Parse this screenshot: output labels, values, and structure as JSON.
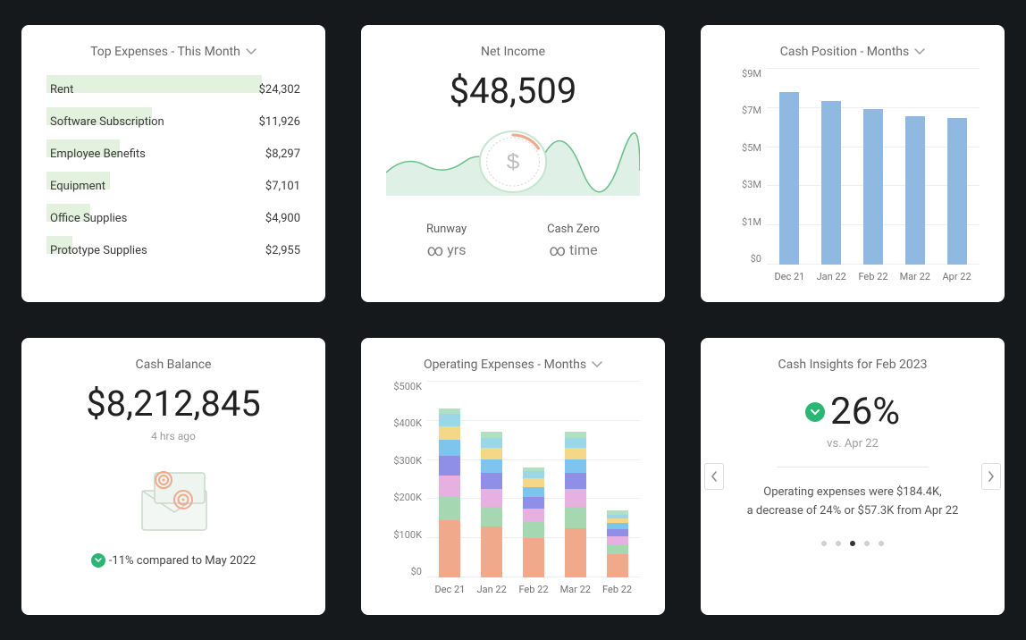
{
  "top_expenses": {
    "title": "Top Expenses - This Month",
    "items": [
      {
        "name": "Rent",
        "value_label": "$24,302",
        "value": 24302
      },
      {
        "name": "Software Subscription",
        "value_label": "$11,926",
        "value": 11926
      },
      {
        "name": "Employee Benefits",
        "value_label": "$8,297",
        "value": 8297
      },
      {
        "name": "Equipment",
        "value_label": "$7,101",
        "value": 7101
      },
      {
        "name": "Office Supplies",
        "value_label": "$4,900",
        "value": 4900
      },
      {
        "name": "Prototype Supplies",
        "value_label": "$2,955",
        "value": 2955
      }
    ]
  },
  "net_income": {
    "title": "Net Income",
    "value": "$48,509",
    "runway_label": "Runway",
    "runway_value": "yrs",
    "cash_zero_label": "Cash Zero",
    "cash_zero_value": "time"
  },
  "cash_position": {
    "title": "Cash Position - Months"
  },
  "cash_balance": {
    "title": "Cash Balance",
    "value": "$8,212,845",
    "updated": "4 hrs ago",
    "compare": "-11% compared to May 2022"
  },
  "op_ex": {
    "title": "Operating Expenses - Months"
  },
  "insights": {
    "title": "Cash Insights for Feb 2023",
    "headline": "26%",
    "vs": "vs. Apr 22",
    "desc1": "Operating expenses were $184.4K,",
    "desc2": "a decrease of 24% or $57.3K from Apr 22",
    "active_dot": 2,
    "dot_count": 5
  },
  "chart_data": [
    {
      "id": "top_expenses_bars",
      "type": "bar",
      "title": "Top Expenses - This Month",
      "categories": [
        "Rent",
        "Software Subscription",
        "Employee Benefits",
        "Equipment",
        "Office Supplies",
        "Prototype Supplies"
      ],
      "values": [
        24302,
        11926,
        8297,
        7101,
        4900,
        2955
      ],
      "orientation": "horizontal"
    },
    {
      "id": "cash_position",
      "type": "bar",
      "title": "Cash Position - Months",
      "ylabel": "",
      "y_ticks": [
        "$9M",
        "$7M",
        "$5M",
        "$3M",
        "$1M",
        "$0"
      ],
      "ylim_millions": [
        0,
        9
      ],
      "categories": [
        "Dec 21",
        "Jan 22",
        "Feb 22",
        "Mar 22",
        "Apr 22"
      ],
      "values_millions": [
        7.9,
        7.5,
        7.1,
        6.8,
        6.7
      ]
    },
    {
      "id": "operating_expenses",
      "type": "bar",
      "stacked": true,
      "title": "Operating Expenses - Months",
      "y_ticks": [
        "$500K",
        "$400K",
        "$300K",
        "$200K",
        "$100K",
        "$0"
      ],
      "ylim_k": [
        0,
        500
      ],
      "categories": [
        "Dec 21",
        "Jan 22",
        "Feb 22",
        "Mar 22",
        "Feb 22"
      ],
      "series": [
        {
          "name": "seg1",
          "color": "#f0a98b",
          "values_k": [
            145,
            130,
            100,
            125,
            60
          ]
        },
        {
          "name": "seg2",
          "color": "#a5d7b0",
          "values_k": [
            60,
            50,
            40,
            55,
            25
          ]
        },
        {
          "name": "seg3",
          "color": "#e7b0e0",
          "values_k": [
            55,
            45,
            35,
            45,
            20
          ]
        },
        {
          "name": "seg4",
          "color": "#8f8fe8",
          "values_k": [
            50,
            40,
            30,
            40,
            18
          ]
        },
        {
          "name": "seg5",
          "color": "#7fc4ef",
          "values_k": [
            40,
            35,
            25,
            35,
            15
          ]
        },
        {
          "name": "seg6",
          "color": "#f5d78a",
          "values_k": [
            35,
            30,
            22,
            30,
            12
          ]
        },
        {
          "name": "seg7",
          "color": "#9ad7e8",
          "values_k": [
            30,
            25,
            18,
            25,
            10
          ]
        },
        {
          "name": "seg8",
          "color": "#b0e0c2",
          "values_k": [
            15,
            15,
            10,
            15,
            10
          ]
        }
      ]
    }
  ]
}
